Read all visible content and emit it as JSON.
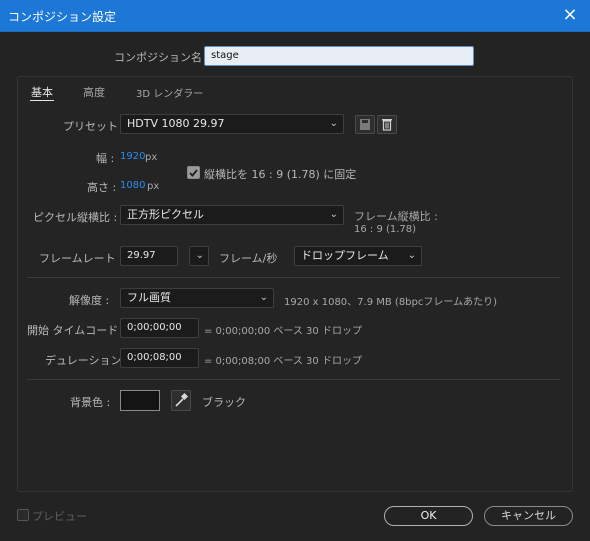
{
  "window": {
    "title": "コンポジション設定",
    "close_icon": "×"
  },
  "name": {
    "label": "コンポジション名 :",
    "value": "stage"
  },
  "tabs": [
    {
      "label": "基本"
    },
    {
      "label": "高度"
    },
    {
      "label": "3D レンダラー"
    }
  ],
  "preset": {
    "label": "プリセット :",
    "value": "HDTV 1080 29.97"
  },
  "width": {
    "label": "幅 :",
    "value": "1920",
    "unit": "px"
  },
  "height": {
    "label": "高さ :",
    "value": "1080",
    "unit": "px"
  },
  "aspect_lock": {
    "label": "縦横比を 16 : 9 (1.78) に固定",
    "checked": true
  },
  "pixel_aspect": {
    "label": "ピクセル縦横比 :",
    "value": "正方形ピクセル"
  },
  "frame_aspect": {
    "label": "フレーム縦横比 :",
    "value": "16 : 9 (1.78)"
  },
  "frame_rate": {
    "label": "フレームレート :",
    "value": "29.97",
    "unit": "フレーム/秒",
    "mode": "ドロップフレーム"
  },
  "resolution": {
    "label": "解像度 :",
    "value": "フル画質",
    "info": "1920 x 1080、7.9 MB (8bpcフレームあたり)"
  },
  "start_timecode": {
    "label": "開始 タイムコード :",
    "value": "0;00;00;00",
    "info": "= 0;00;00;00 ベース 30 ドロップ"
  },
  "duration": {
    "label": "デュレーション :",
    "value": "0;00;08;00",
    "info": "= 0;00;08;00 ベース 30 ドロップ"
  },
  "background": {
    "label": "背景色 :",
    "color": "#141414",
    "color_name": "ブラック"
  },
  "footer": {
    "preview_label": "プレビュー",
    "ok_label": "OK",
    "cancel_label": "キャンセル"
  },
  "colors": {
    "accent": "#1c77d6",
    "link": "#2d8ceb"
  }
}
